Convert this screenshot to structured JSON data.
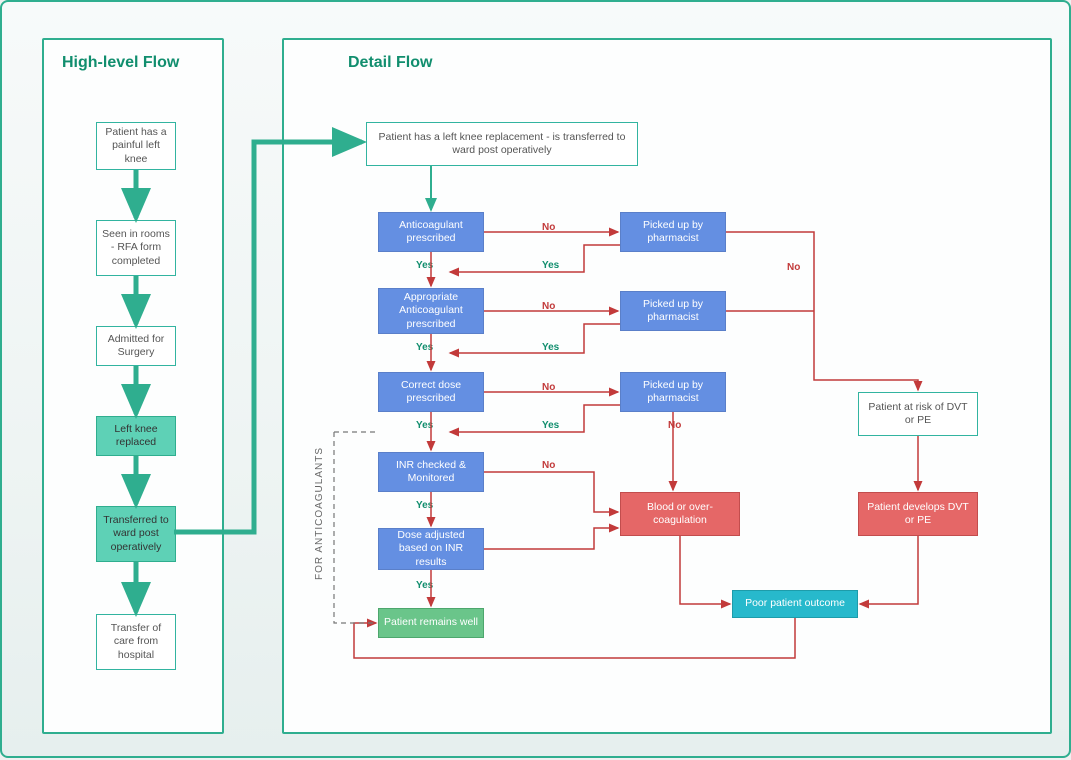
{
  "high_level": {
    "title": "High-level Flow",
    "n1": "Patient has a painful left knee",
    "n2": "Seen in rooms - RFA form completed",
    "n3": "Admitted for Surgery",
    "n4": "Left knee replaced",
    "n5": "Transferred to ward post operatively",
    "n6": "Transfer of care from hospital"
  },
  "detail": {
    "title": "Detail Flow",
    "start": "Patient has a left knee replacement - is transferred to ward post operatively",
    "d1": "Anticoagulant prescribed",
    "d2": "Appropriate Anticoagulant prescribed",
    "d3": "Correct dose prescribed",
    "d4": "INR checked & Monitored",
    "d5": "Dose adjusted based on INR results",
    "p1": "Picked up by pharmacist",
    "p2": "Picked up by pharmacist",
    "p3": "Picked up by pharmacist",
    "risk": "Patient at risk of DVT or PE",
    "dvt": "Patient develops DVT or PE",
    "blood": "Blood or over-coagulation",
    "poor": "Poor patient outcome",
    "well": "Patient remains well",
    "side_label": "FOR ANTICOAGULANTS"
  },
  "labels": {
    "yes": "Yes",
    "no": "No"
  }
}
